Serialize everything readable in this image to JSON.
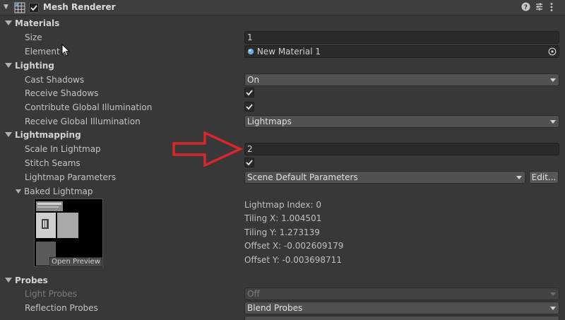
{
  "header": {
    "title": "Mesh Renderer",
    "enabled": true,
    "tools": [
      "help-icon",
      "presets-icon",
      "more-icon"
    ]
  },
  "materials": {
    "section_label": "Materials",
    "size_label": "Size",
    "size_value": "1",
    "element_label": "Element 0",
    "element_value": "New Material 1"
  },
  "lighting": {
    "section_label": "Lighting",
    "cast_shadows_label": "Cast Shadows",
    "cast_shadows_value": "On",
    "receive_shadows_label": "Receive Shadows",
    "contribute_gi_label": "Contribute Global Illumination",
    "receive_gi_label": "Receive Global Illumination",
    "receive_gi_value": "Lightmaps"
  },
  "lightmapping": {
    "section_label": "Lightmapping",
    "scale_label": "Scale In Lightmap",
    "scale_value": "2",
    "stitch_label": "Stitch Seams",
    "params_label": "Lightmap Parameters",
    "params_value": "Scene Default Parameters",
    "edit_label": "Edit...",
    "baked_label": "Baked Lightmap",
    "open_preview_label": "Open Preview",
    "index_text": "Lightmap Index: 0",
    "tiling_x_text": "Tiling X: 1.004501",
    "tiling_y_text": "Tiling Y: 1.273139",
    "offset_x_text": "Offset X: -0.002609179",
    "offset_y_text": "Offset Y: -0.003698711"
  },
  "probes": {
    "section_label": "Probes",
    "light_probes_label": "Light Probes",
    "light_probes_value": "Off",
    "reflection_probes_label": "Reflection Probes",
    "reflection_probes_value": "Blend Probes"
  },
  "colors": {
    "panel_bg": "#383838",
    "field_bg": "#2a2a2a",
    "dropdown_bg": "#515151",
    "annotation_arrow": "#d8262b"
  }
}
